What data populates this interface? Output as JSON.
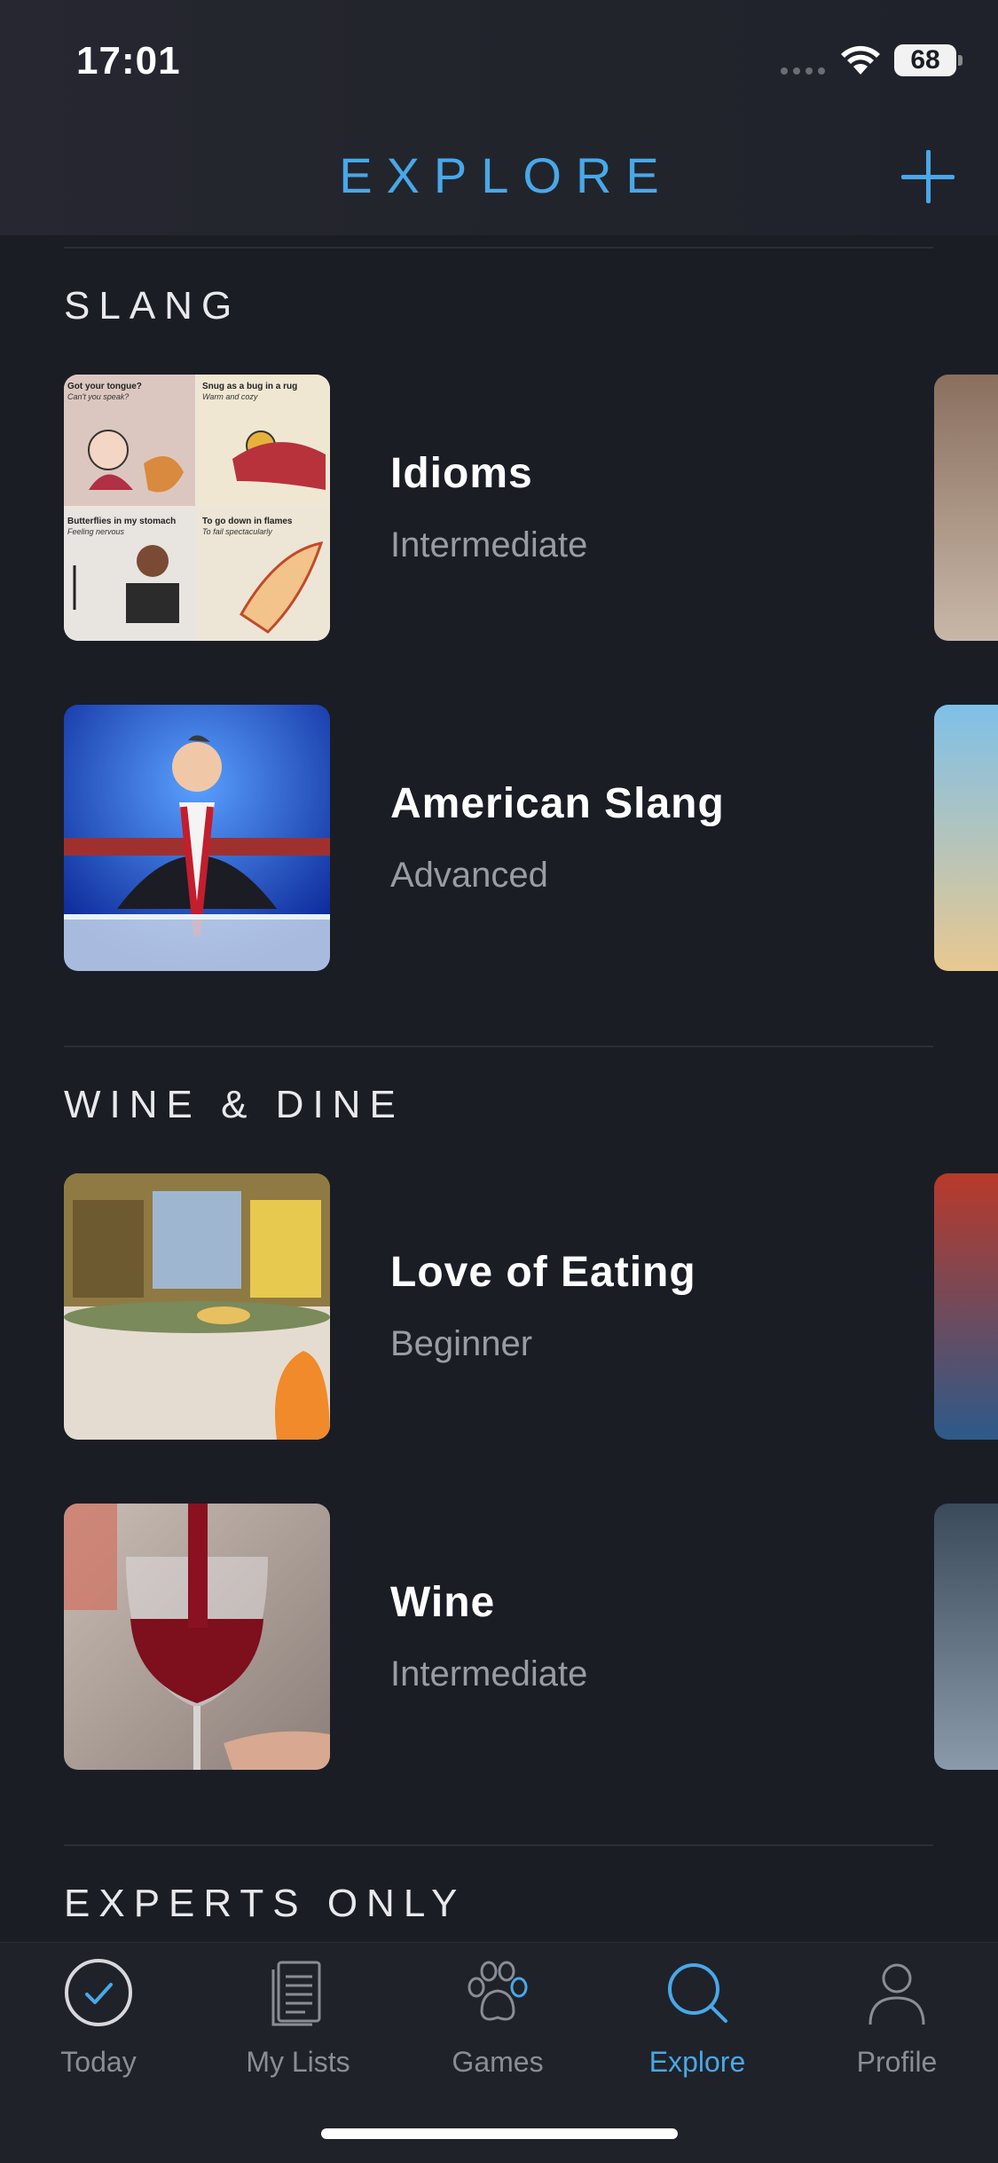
{
  "status": {
    "time": "17:01",
    "battery": "68"
  },
  "header": {
    "title": "EXPLORE"
  },
  "sections": [
    {
      "title": "SLANG",
      "items": [
        {
          "title": "Idioms",
          "level": "Intermediate"
        },
        {
          "title": "American Slang",
          "level": "Advanced"
        }
      ]
    },
    {
      "title": "WINE & DINE",
      "items": [
        {
          "title": "Love of Eating",
          "level": "Beginner"
        },
        {
          "title": "Wine",
          "level": "Intermediate"
        }
      ]
    },
    {
      "title": "EXPERTS ONLY",
      "items": []
    }
  ],
  "idioms_thumb_text": {
    "panel1_title": "Got your tongue?",
    "panel1_sub": "Can't you speak?",
    "panel2_title": "Snug as a bug in a rug",
    "panel2_sub": "Warm and cozy",
    "panel3_title": "Butterflies in my stomach",
    "panel3_sub": "Feeling nervous",
    "panel4_title": "To go down in flames",
    "panel4_sub": "To fail spectacularly"
  },
  "tabbar": {
    "tabs": [
      {
        "label": "Today",
        "icon": "checkmark-circle-icon",
        "active": false
      },
      {
        "label": "My Lists",
        "icon": "document-list-icon",
        "active": false
      },
      {
        "label": "Games",
        "icon": "paw-icon",
        "active": false
      },
      {
        "label": "Explore",
        "icon": "search-icon",
        "active": true
      },
      {
        "label": "Profile",
        "icon": "person-icon",
        "active": false
      }
    ]
  },
  "colors": {
    "accent": "#48a8e8",
    "background": "#1b1d25",
    "secondary_text": "#9a9ca4"
  }
}
